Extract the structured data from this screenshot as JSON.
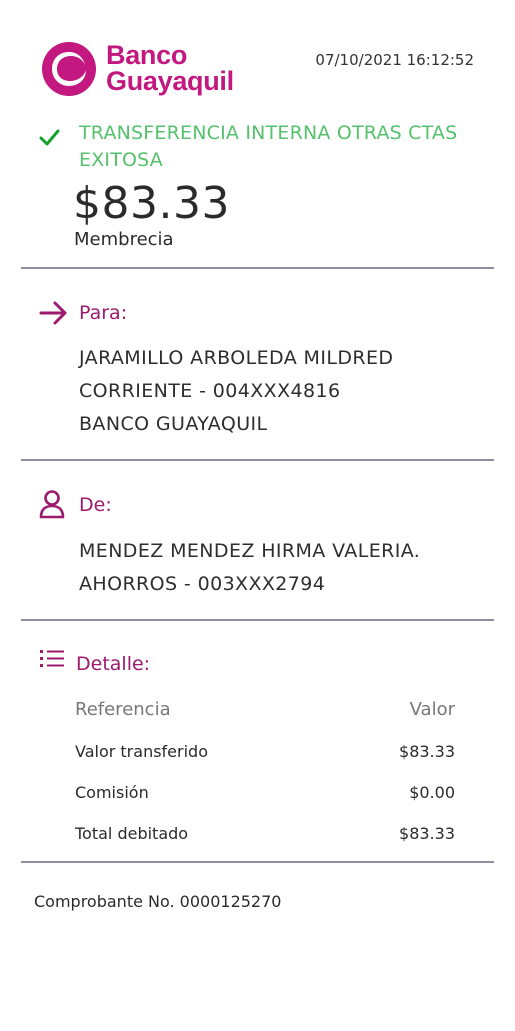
{
  "header": {
    "brand_line1": "Banco",
    "brand_line2": "Guayaquil",
    "timestamp": "07/10/2021 16:12:52",
    "brand_color": "#c2187f"
  },
  "status": {
    "icon": "check-icon",
    "text": "TRANSFERENCIA INTERNA OTRAS CTAS EXITOSA",
    "color": "#56c16c"
  },
  "amount": "$83.33",
  "concept": "Membrecia",
  "para": {
    "icon": "arrow-right-icon",
    "label": "Para:",
    "name": "JARAMILLO ARBOLEDA MILDRED",
    "account": "CORRIENTE - 004XXX4816",
    "bank": "BANCO GUAYAQUIL"
  },
  "de": {
    "icon": "user-icon",
    "label": "De:",
    "name": "MENDEZ MENDEZ HIRMA VALERIA.",
    "account": "AHORROS - 003XXX2794"
  },
  "detalle": {
    "icon": "list-icon",
    "label": "Detalle:",
    "col_ref": "Referencia",
    "col_val": "Valor",
    "rows": [
      {
        "label": "Valor transferido",
        "value": "$83.33"
      },
      {
        "label": "Comisión",
        "value": "$0.00"
      },
      {
        "label": "Total debitado",
        "value": "$83.33"
      }
    ]
  },
  "voucher": "Comprobante No. 0000125270"
}
